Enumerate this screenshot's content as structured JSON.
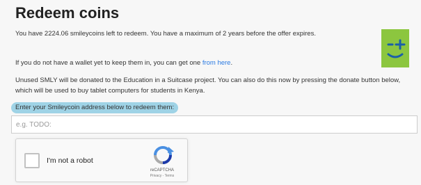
{
  "page": {
    "title": "Redeem coins",
    "p1": "You have 2224.06 smileycoins left to redeem. You have a maximum of 2 years before the offer expires.",
    "p2_prefix": "If you do not have a wallet yet to keep them in, you can get one ",
    "p2_link": "from here",
    "p2_suffix": ".",
    "p3": "Unused SMLY will be donated to the Education in a Suitcase project. You can also do this now by pressing the donate button below, which will be used to buy tablet computers for students in Kenya."
  },
  "form": {
    "address_label": "Enter your Smileycoin address below to redeem them:",
    "address_placeholder": "e.g. TODO:",
    "address_value": ""
  },
  "captcha": {
    "label": "I'm not a robot",
    "brand": "reCAPTCHA",
    "privacy": "Privacy",
    "separator": "-",
    "terms": "Terms"
  },
  "colors": {
    "logo_bg": "#8cc63f",
    "logo_fg": "#1a5fa8",
    "link": "#2a7ae2",
    "highlight": "#9fd3e6"
  },
  "icons": {
    "logo": "smileycoin-logo",
    "captcha": "recaptcha-icon"
  }
}
